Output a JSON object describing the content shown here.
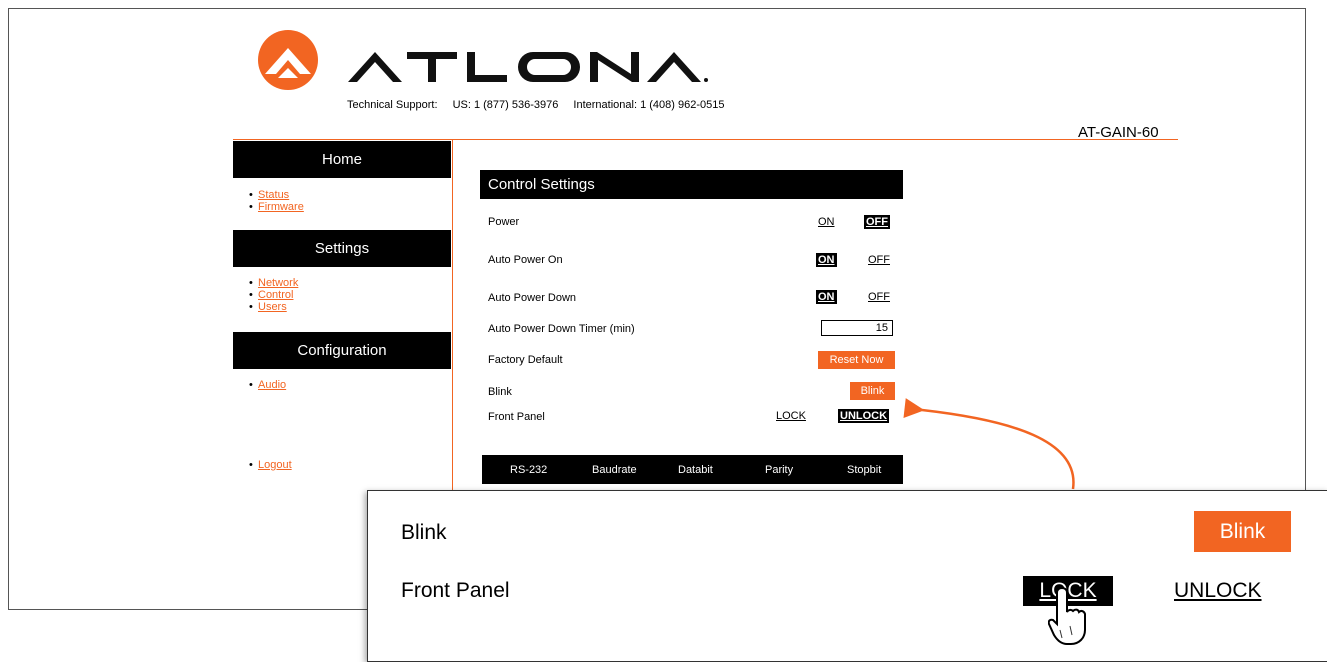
{
  "brand": {
    "name": "ATLONA",
    "accent": "#f26522"
  },
  "support": {
    "label": "Technical Support:",
    "us": "US: 1 (877) 536-3976",
    "intl": "International: 1 (408) 962-0515"
  },
  "model": "AT-GAIN-60",
  "nav": {
    "home": {
      "title": "Home",
      "items": [
        "Status",
        "Firmware"
      ]
    },
    "settings": {
      "title": "Settings",
      "items": [
        "Network",
        "Control",
        "Users"
      ]
    },
    "configuration": {
      "title": "Configuration",
      "items": [
        "Audio"
      ]
    },
    "logout": "Logout"
  },
  "control": {
    "title": "Control Settings",
    "power": {
      "label": "Power",
      "on": "ON",
      "off": "OFF",
      "selected": "OFF"
    },
    "auto_power_on": {
      "label": "Auto Power On",
      "on": "ON",
      "off": "OFF",
      "selected": "ON"
    },
    "auto_power_down": {
      "label": "Auto Power Down",
      "on": "ON",
      "off": "OFF",
      "selected": "ON"
    },
    "timer": {
      "label": "Auto Power Down Timer (min)",
      "value": "15"
    },
    "factory_default": {
      "label": "Factory Default",
      "button": "Reset Now"
    },
    "blink": {
      "label": "Blink",
      "button": "Blink"
    },
    "front_panel": {
      "label": "Front Panel",
      "lock": "LOCK",
      "unlock": "UNLOCK",
      "selected": "UNLOCK"
    }
  },
  "rs232": {
    "headers": [
      "RS-232",
      "Baudrate",
      "Databit",
      "Parity",
      "Stopbit"
    ]
  },
  "zoom": {
    "blink_label": "Blink",
    "blink_button": "Blink",
    "front_panel_label": "Front Panel",
    "lock": "LOCK",
    "unlock": "UNLOCK",
    "selected": "LOCK"
  }
}
